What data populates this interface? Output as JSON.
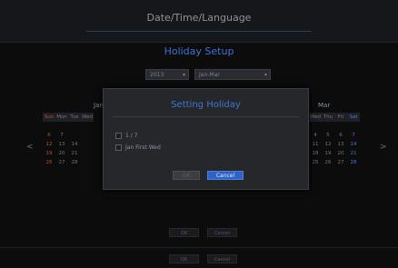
{
  "header": {
    "title": "Date/Time/Language"
  },
  "holiday": {
    "title": "Holiday Setup",
    "year": "2013",
    "month_range": "Jan-Mar",
    "left_month": "Jan",
    "right_month": "Mar",
    "weekdays_left": [
      "Sun",
      "Mon",
      "Tue",
      "Wed"
    ],
    "weekdays_right": [
      "Wed",
      "Thu",
      "Fri",
      "Sat"
    ],
    "left_rows": [
      [
        "",
        "",
        "",
        ""
      ],
      [
        "6",
        "7",
        "",
        ""
      ],
      [
        "12",
        "13",
        "14",
        ""
      ],
      [
        "19",
        "20",
        "21",
        ""
      ],
      [
        "26",
        "27",
        "28",
        ""
      ]
    ],
    "right_rows": [
      [
        "",
        "",
        "",
        ""
      ],
      [
        "4",
        "5",
        "6",
        "7"
      ],
      [
        "11",
        "12",
        "13",
        "14"
      ],
      [
        "18",
        "19",
        "20",
        "21"
      ],
      [
        "25",
        "26",
        "27",
        "28"
      ]
    ],
    "prev_arrow": "<",
    "next_arrow": ">"
  },
  "dialog": {
    "title": "Setting Holiday",
    "option1": "1 / 7",
    "option2": "Jan First Wed",
    "ok_label": "OK",
    "cancel_label": "Cancel"
  },
  "footer": {
    "ok_label": "OK",
    "cancel_label": "Cancel"
  },
  "colors": {
    "accent": "#3f75d6",
    "sunday": "#b0552c",
    "saturday": "#4b79cf"
  }
}
